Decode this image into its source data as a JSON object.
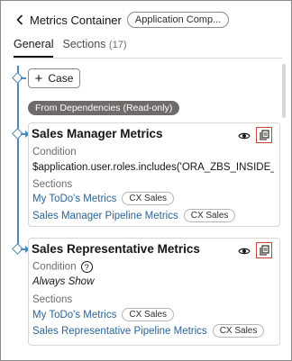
{
  "header": {
    "title": "Metrics Container",
    "chip": "Application Comp..."
  },
  "tabs": [
    {
      "label": "General",
      "count": ""
    },
    {
      "label": "Sections",
      "count": "(17)"
    }
  ],
  "add_case_label": "Case",
  "dependency_pill": "From Dependencies (Read-only)",
  "cards": [
    {
      "title": "Sales Manager Metrics",
      "condition_label": "Condition",
      "condition_value": "$application.user.roles.includes('ORA_ZBS_INSIDE_SALE...",
      "sections_label": "Sections",
      "sections": [
        {
          "name": "My ToDo's Metrics",
          "tag": "CX Sales"
        },
        {
          "name": "Sales Manager Pipeline Metrics",
          "tag": "CX Sales"
        }
      ]
    },
    {
      "title": "Sales Representative Metrics",
      "condition_label": "Condition",
      "condition_value": "Always Show",
      "sections_label": "Sections",
      "sections": [
        {
          "name": "My ToDo's Metrics",
          "tag": "CX Sales"
        },
        {
          "name": "Sales Representative Pipeline Metrics",
          "tag": "CX Sales"
        }
      ]
    }
  ],
  "colors": {
    "accent_line": "#4e88b8",
    "highlight": "#c74634",
    "link": "#2a6496"
  }
}
